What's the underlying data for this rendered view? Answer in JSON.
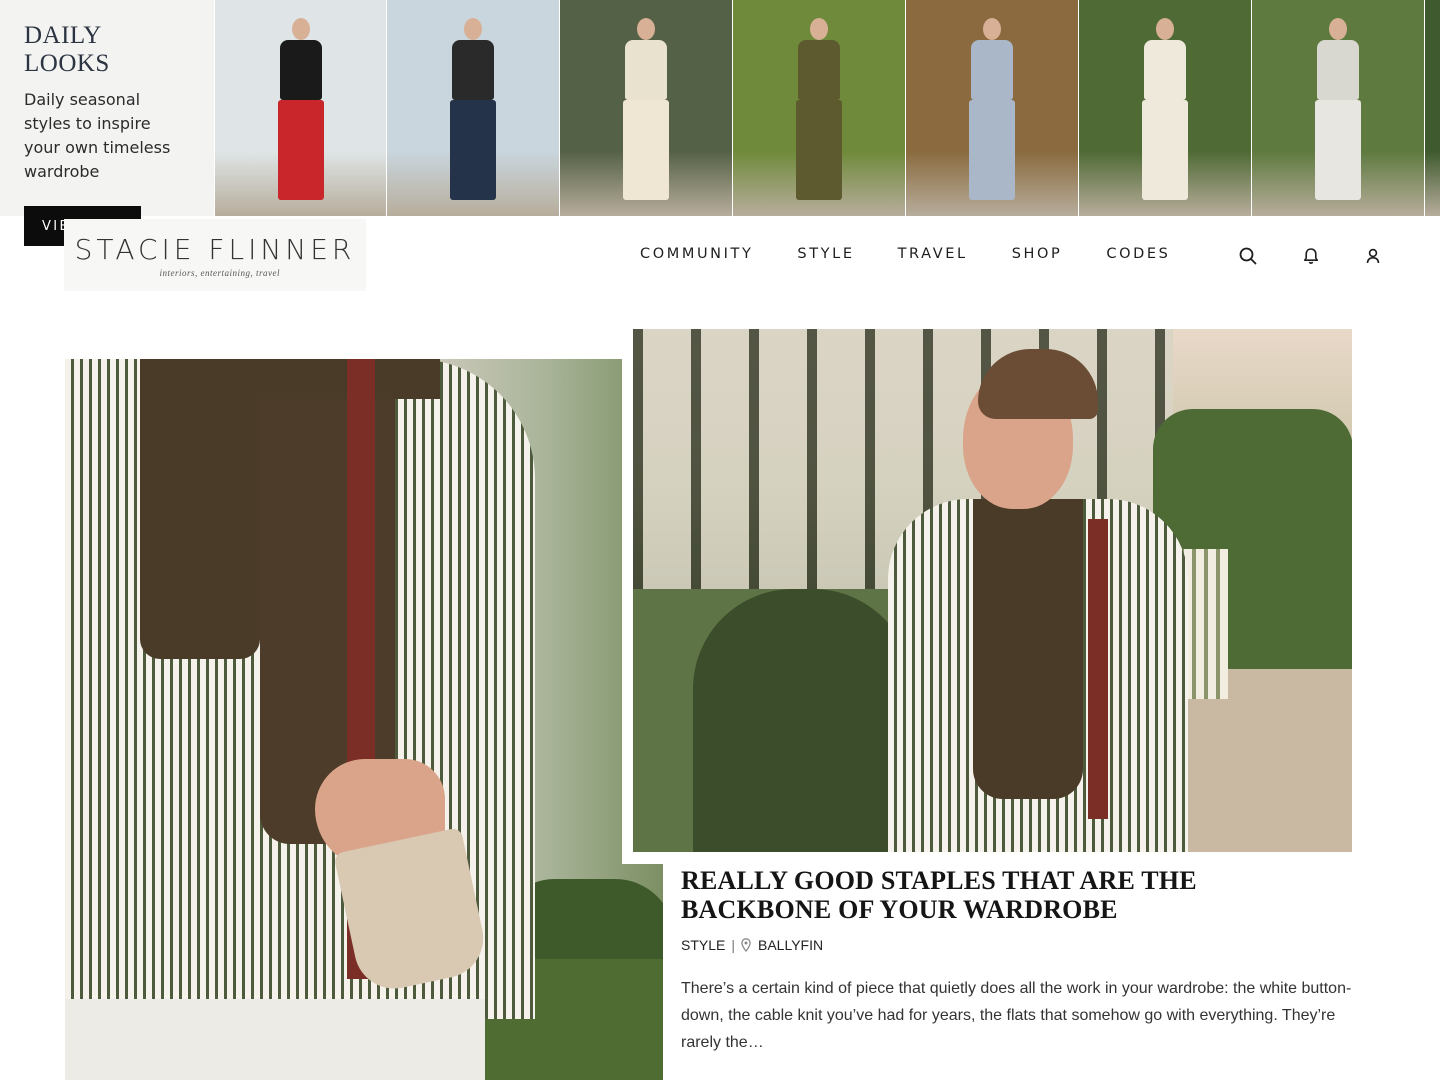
{
  "daily_looks": {
    "title": "DAILY LOOKS",
    "subtitle": "Daily seasonal styles to inspire your own timeless wardrobe",
    "view_all_label": "VIEW ALL",
    "tiles": [
      {
        "name": "look-black-top-red-skirt",
        "bg": "#dfe5e6",
        "top": "#1a1a1a",
        "bottom": "#c8262b"
      },
      {
        "name": "look-striped-halter-jeans",
        "bg": "#c9d6dd",
        "top": "#2a2a2a",
        "bottom": "#24324a"
      },
      {
        "name": "look-white-dress-garden",
        "bg": "#556146",
        "top": "#e9e2cf",
        "bottom": "#efe7d4"
      },
      {
        "name": "look-olive-dress-picnic",
        "bg": "#6f8a3a",
        "top": "#5c5a2e",
        "bottom": "#5c5a2e"
      },
      {
        "name": "look-blue-print-pajamas",
        "bg": "#8a6a3e",
        "top": "#a9b7c9",
        "bottom": "#a9b7c9"
      },
      {
        "name": "look-white-lace-dress",
        "bg": "#4f6a35",
        "top": "#efe9dc",
        "bottom": "#efe9dc"
      },
      {
        "name": "look-stripe-shirt-sweater",
        "bg": "#5f7a3f",
        "top": "#d8d8d0",
        "bottom": "#e8e6e0"
      },
      {
        "name": "look-partial-green",
        "bg": "#3f5a2e",
        "top": "#3f5a2e",
        "bottom": "#3f5a2e"
      }
    ]
  },
  "header": {
    "logo_name": "STACIE FLINNER",
    "logo_tagline": "interiors, entertaining, travel",
    "nav": [
      "COMMUNITY",
      "STYLE",
      "TRAVEL",
      "SHOP",
      "CODES"
    ],
    "icons": [
      "search-icon",
      "bell-icon",
      "user-icon"
    ]
  },
  "post": {
    "title": "REALLY GOOD STAPLES THAT ARE THE BACKBONE OF YOUR WARDROBE",
    "category": "STYLE",
    "separator": "|",
    "location": "BALLYFIN",
    "excerpt": "There’s a certain kind of piece that quietly does all the work in your wardrobe: the white button-down, the cable knit you’ve had for years, the flats that somehow go with everything. They’re rarely the…"
  },
  "colors": {
    "sweater": "#4a3a28",
    "shirt_stripe": "#4d5a3c",
    "bag_strap": "#7a2e26",
    "canvas_bag": "#d9c8b2"
  }
}
